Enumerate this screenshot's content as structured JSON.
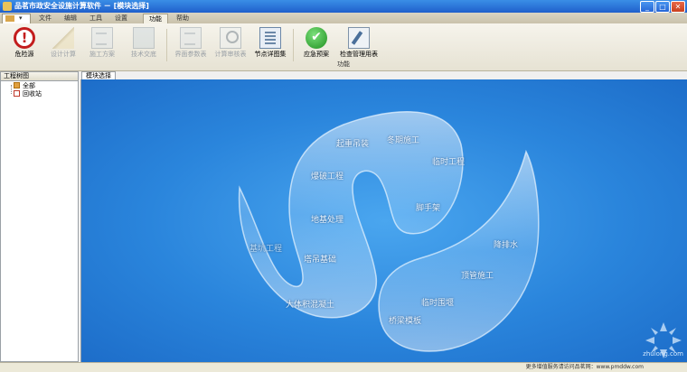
{
  "window": {
    "title": "品茗市政安全设施计算软件 － [模块选择]"
  },
  "menu": {
    "tabs": [
      {
        "label": "文件"
      },
      {
        "label": "编辑"
      },
      {
        "label": "工具"
      },
      {
        "label": "设置"
      },
      {
        "label": "功能",
        "active": true
      },
      {
        "label": "帮助"
      }
    ]
  },
  "ribbon": {
    "buttons": [
      {
        "label": "危险源",
        "icon": "danger-icon",
        "enabled": true
      },
      {
        "label": "设计计算",
        "icon": "triangle-ruler-icon",
        "enabled": false
      },
      {
        "label": "施工方案",
        "icon": "document-icon",
        "enabled": false
      },
      {
        "label": "技术交底",
        "icon": "book-icon",
        "enabled": false
      },
      {
        "label": "界面参数表",
        "icon": "table-icon",
        "enabled": false
      },
      {
        "label": "计算审核表",
        "icon": "magnifier-icon",
        "enabled": false
      },
      {
        "label": "节点详图集",
        "icon": "node-drawing-icon",
        "enabled": true
      },
      {
        "label": "应急预案",
        "icon": "check-icon",
        "enabled": true
      },
      {
        "label": "检查管理用表",
        "icon": "inspection-icon",
        "enabled": true
      }
    ],
    "group_label": "功能"
  },
  "left_pane": {
    "title": "工程树图",
    "tree": [
      {
        "label": "全部",
        "icon": "folder-icon"
      },
      {
        "label": "回收站",
        "icon": "recycle-bin-icon"
      }
    ]
  },
  "module_tab": {
    "label": "模块选择"
  },
  "modules": [
    {
      "label": "起重吊装"
    },
    {
      "label": "冬期施工"
    },
    {
      "label": "爆破工程"
    },
    {
      "label": "临时工程"
    },
    {
      "label": "脚手架"
    },
    {
      "label": "地基处理"
    },
    {
      "label": "基坑工程"
    },
    {
      "label": "塔吊基础"
    },
    {
      "label": "降排水"
    },
    {
      "label": "顶管施工"
    },
    {
      "label": "大体积混凝土"
    },
    {
      "label": "临时围堰"
    },
    {
      "label": "桥梁模板"
    }
  ],
  "statusbar": {
    "text": "更多增值服务请访问品茗网：www.pmddw.com"
  },
  "watermark": {
    "text": "zhulong.com"
  },
  "colors": {
    "main_bg": "#2a85dc",
    "title_bar": "#1f5fcc",
    "danger": "#c31d1d",
    "check": "#1f8f1f"
  }
}
